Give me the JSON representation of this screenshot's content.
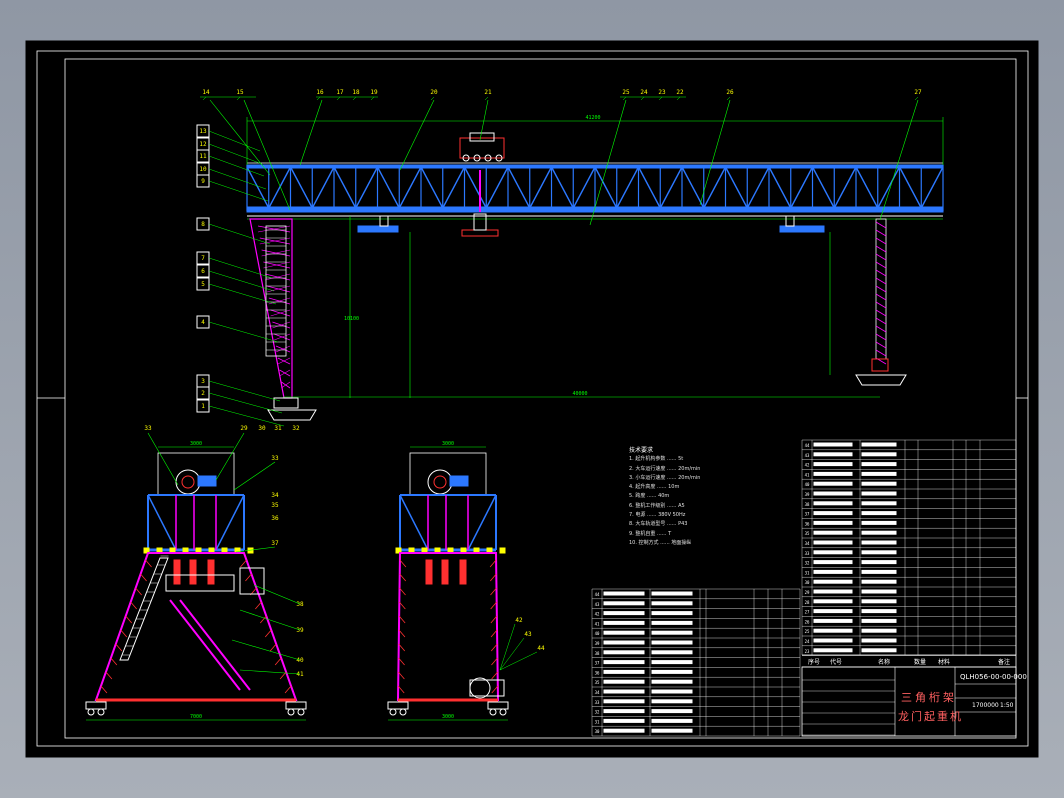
{
  "drawing": {
    "title_line1": "三角桁架",
    "title_line2": "龙门起重机",
    "drawing_no": "QLH056-00-00-000",
    "scale": "1:50",
    "weight_code": "1700000"
  },
  "dimensions": {
    "span": "40000",
    "total_length": "41200",
    "height_under_beam": "10100",
    "base_width_left": "7000",
    "base_width_right": "3000",
    "top_width_left": "3000",
    "top_width_right": "3000"
  },
  "elevation_callouts_top": [
    "14",
    "15",
    "16",
    "17",
    "18",
    "19",
    "20",
    "21",
    "25",
    "24",
    "23",
    "22",
    "26",
    "27"
  ],
  "elevation_callouts_left": [
    "13",
    "12",
    "11",
    "10",
    "9",
    "8",
    "7",
    "6",
    "5",
    "4",
    "3",
    "2",
    "1"
  ],
  "section_callouts_left": [
    "33",
    "29",
    "30",
    "31",
    "32",
    "33",
    "34",
    "35",
    "36",
    "37",
    "38",
    "39",
    "40",
    "41"
  ],
  "section_callouts_right": [
    "42",
    "43",
    "44"
  ],
  "tech_notes": {
    "title": "技术要求",
    "lines": [
      "1. 起升机构参数 ...... 5t",
      "2. 大车运行速度 ...... 20m/min",
      "3. 小车运行速度 ...... 20m/min",
      "4. 起升高度 ...... 10m",
      "5. 跨度 ...... 40m",
      "6. 整机工作级别 ...... A5",
      "7. 电源 ...... 380V 50Hz",
      "8. 大车轨道型号 ...... P43",
      "9. 整机自重 ...... T",
      "10. 控制方式 ...... 地面操纵"
    ]
  },
  "table_headers": {
    "seq": "序号",
    "code": "代号",
    "name": "名称",
    "qty": "数量",
    "material": "材料",
    "remark": "备注"
  }
}
